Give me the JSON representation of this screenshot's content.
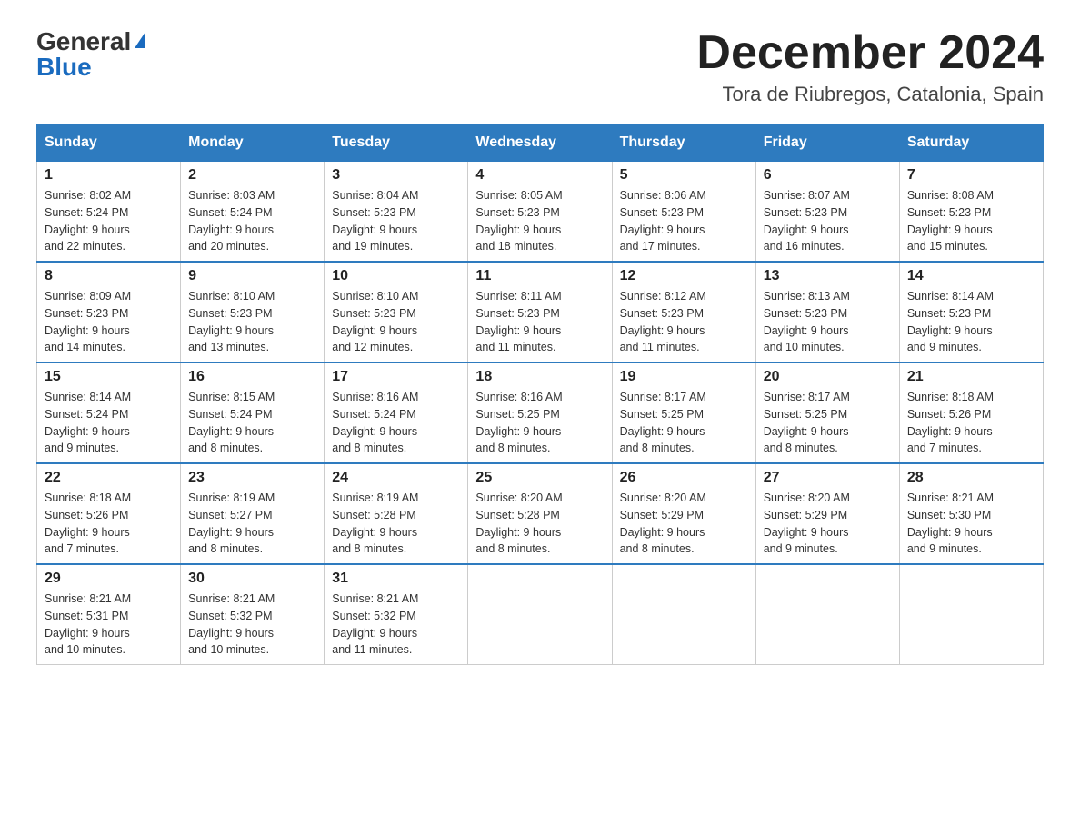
{
  "header": {
    "logo_general": "General",
    "logo_blue": "Blue",
    "month": "December 2024",
    "location": "Tora de Riubregos, Catalonia, Spain"
  },
  "days_of_week": [
    "Sunday",
    "Monday",
    "Tuesday",
    "Wednesday",
    "Thursday",
    "Friday",
    "Saturday"
  ],
  "weeks": [
    [
      {
        "day": "1",
        "sunrise": "8:02 AM",
        "sunset": "5:24 PM",
        "daylight": "9 hours and 22 minutes."
      },
      {
        "day": "2",
        "sunrise": "8:03 AM",
        "sunset": "5:24 PM",
        "daylight": "9 hours and 20 minutes."
      },
      {
        "day": "3",
        "sunrise": "8:04 AM",
        "sunset": "5:23 PM",
        "daylight": "9 hours and 19 minutes."
      },
      {
        "day": "4",
        "sunrise": "8:05 AM",
        "sunset": "5:23 PM",
        "daylight": "9 hours and 18 minutes."
      },
      {
        "day": "5",
        "sunrise": "8:06 AM",
        "sunset": "5:23 PM",
        "daylight": "9 hours and 17 minutes."
      },
      {
        "day": "6",
        "sunrise": "8:07 AM",
        "sunset": "5:23 PM",
        "daylight": "9 hours and 16 minutes."
      },
      {
        "day": "7",
        "sunrise": "8:08 AM",
        "sunset": "5:23 PM",
        "daylight": "9 hours and 15 minutes."
      }
    ],
    [
      {
        "day": "8",
        "sunrise": "8:09 AM",
        "sunset": "5:23 PM",
        "daylight": "9 hours and 14 minutes."
      },
      {
        "day": "9",
        "sunrise": "8:10 AM",
        "sunset": "5:23 PM",
        "daylight": "9 hours and 13 minutes."
      },
      {
        "day": "10",
        "sunrise": "8:10 AM",
        "sunset": "5:23 PM",
        "daylight": "9 hours and 12 minutes."
      },
      {
        "day": "11",
        "sunrise": "8:11 AM",
        "sunset": "5:23 PM",
        "daylight": "9 hours and 11 minutes."
      },
      {
        "day": "12",
        "sunrise": "8:12 AM",
        "sunset": "5:23 PM",
        "daylight": "9 hours and 11 minutes."
      },
      {
        "day": "13",
        "sunrise": "8:13 AM",
        "sunset": "5:23 PM",
        "daylight": "9 hours and 10 minutes."
      },
      {
        "day": "14",
        "sunrise": "8:14 AM",
        "sunset": "5:23 PM",
        "daylight": "9 hours and 9 minutes."
      }
    ],
    [
      {
        "day": "15",
        "sunrise": "8:14 AM",
        "sunset": "5:24 PM",
        "daylight": "9 hours and 9 minutes."
      },
      {
        "day": "16",
        "sunrise": "8:15 AM",
        "sunset": "5:24 PM",
        "daylight": "9 hours and 8 minutes."
      },
      {
        "day": "17",
        "sunrise": "8:16 AM",
        "sunset": "5:24 PM",
        "daylight": "9 hours and 8 minutes."
      },
      {
        "day": "18",
        "sunrise": "8:16 AM",
        "sunset": "5:25 PM",
        "daylight": "9 hours and 8 minutes."
      },
      {
        "day": "19",
        "sunrise": "8:17 AM",
        "sunset": "5:25 PM",
        "daylight": "9 hours and 8 minutes."
      },
      {
        "day": "20",
        "sunrise": "8:17 AM",
        "sunset": "5:25 PM",
        "daylight": "9 hours and 8 minutes."
      },
      {
        "day": "21",
        "sunrise": "8:18 AM",
        "sunset": "5:26 PM",
        "daylight": "9 hours and 7 minutes."
      }
    ],
    [
      {
        "day": "22",
        "sunrise": "8:18 AM",
        "sunset": "5:26 PM",
        "daylight": "9 hours and 7 minutes."
      },
      {
        "day": "23",
        "sunrise": "8:19 AM",
        "sunset": "5:27 PM",
        "daylight": "9 hours and 8 minutes."
      },
      {
        "day": "24",
        "sunrise": "8:19 AM",
        "sunset": "5:28 PM",
        "daylight": "9 hours and 8 minutes."
      },
      {
        "day": "25",
        "sunrise": "8:20 AM",
        "sunset": "5:28 PM",
        "daylight": "9 hours and 8 minutes."
      },
      {
        "day": "26",
        "sunrise": "8:20 AM",
        "sunset": "5:29 PM",
        "daylight": "9 hours and 8 minutes."
      },
      {
        "day": "27",
        "sunrise": "8:20 AM",
        "sunset": "5:29 PM",
        "daylight": "9 hours and 9 minutes."
      },
      {
        "day": "28",
        "sunrise": "8:21 AM",
        "sunset": "5:30 PM",
        "daylight": "9 hours and 9 minutes."
      }
    ],
    [
      {
        "day": "29",
        "sunrise": "8:21 AM",
        "sunset": "5:31 PM",
        "daylight": "9 hours and 10 minutes."
      },
      {
        "day": "30",
        "sunrise": "8:21 AM",
        "sunset": "5:32 PM",
        "daylight": "9 hours and 10 minutes."
      },
      {
        "day": "31",
        "sunrise": "8:21 AM",
        "sunset": "5:32 PM",
        "daylight": "9 hours and 11 minutes."
      },
      null,
      null,
      null,
      null
    ]
  ],
  "labels": {
    "sunrise": "Sunrise:",
    "sunset": "Sunset:",
    "daylight": "Daylight:"
  }
}
